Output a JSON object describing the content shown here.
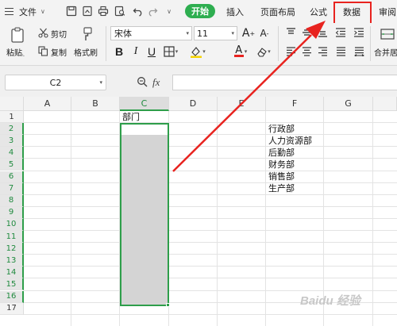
{
  "menu": {
    "file_label": "文件",
    "tabs": [
      {
        "label": "开始",
        "active": true
      },
      {
        "label": "插入"
      },
      {
        "label": "页面布局"
      },
      {
        "label": "公式"
      },
      {
        "label": "数据",
        "highlighted": true
      },
      {
        "label": "审阅"
      }
    ],
    "accent_color": "#2eae50",
    "highlight_color": "#e8231f"
  },
  "ribbon": {
    "paste_label": "粘贴",
    "cut_label": "剪切",
    "copy_label": "复制",
    "format_painter_label": "格式刷",
    "font_name": "宋体",
    "font_size": "11",
    "bold": "B",
    "italic": "I",
    "underline": "U",
    "font_color_glyph": "A",
    "merge_label": "合并居"
  },
  "formula_bar": {
    "cell_ref": "C2",
    "fx_label": "fx",
    "formula_value": ""
  },
  "sheet": {
    "columns": [
      "A",
      "B",
      "C",
      "D",
      "E",
      "F",
      "G"
    ],
    "rows": [
      "1",
      "2",
      "3",
      "4",
      "5",
      "6",
      "7",
      "8",
      "9",
      "10",
      "11",
      "12",
      "13",
      "14",
      "15",
      "16",
      "17"
    ],
    "selected_column": "C",
    "c1": "部门",
    "departments": [
      "行政部",
      "人力资源部",
      "后勤部",
      "财务部",
      "销售部",
      "生产部"
    ]
  },
  "watermark": "Baidu 经验"
}
